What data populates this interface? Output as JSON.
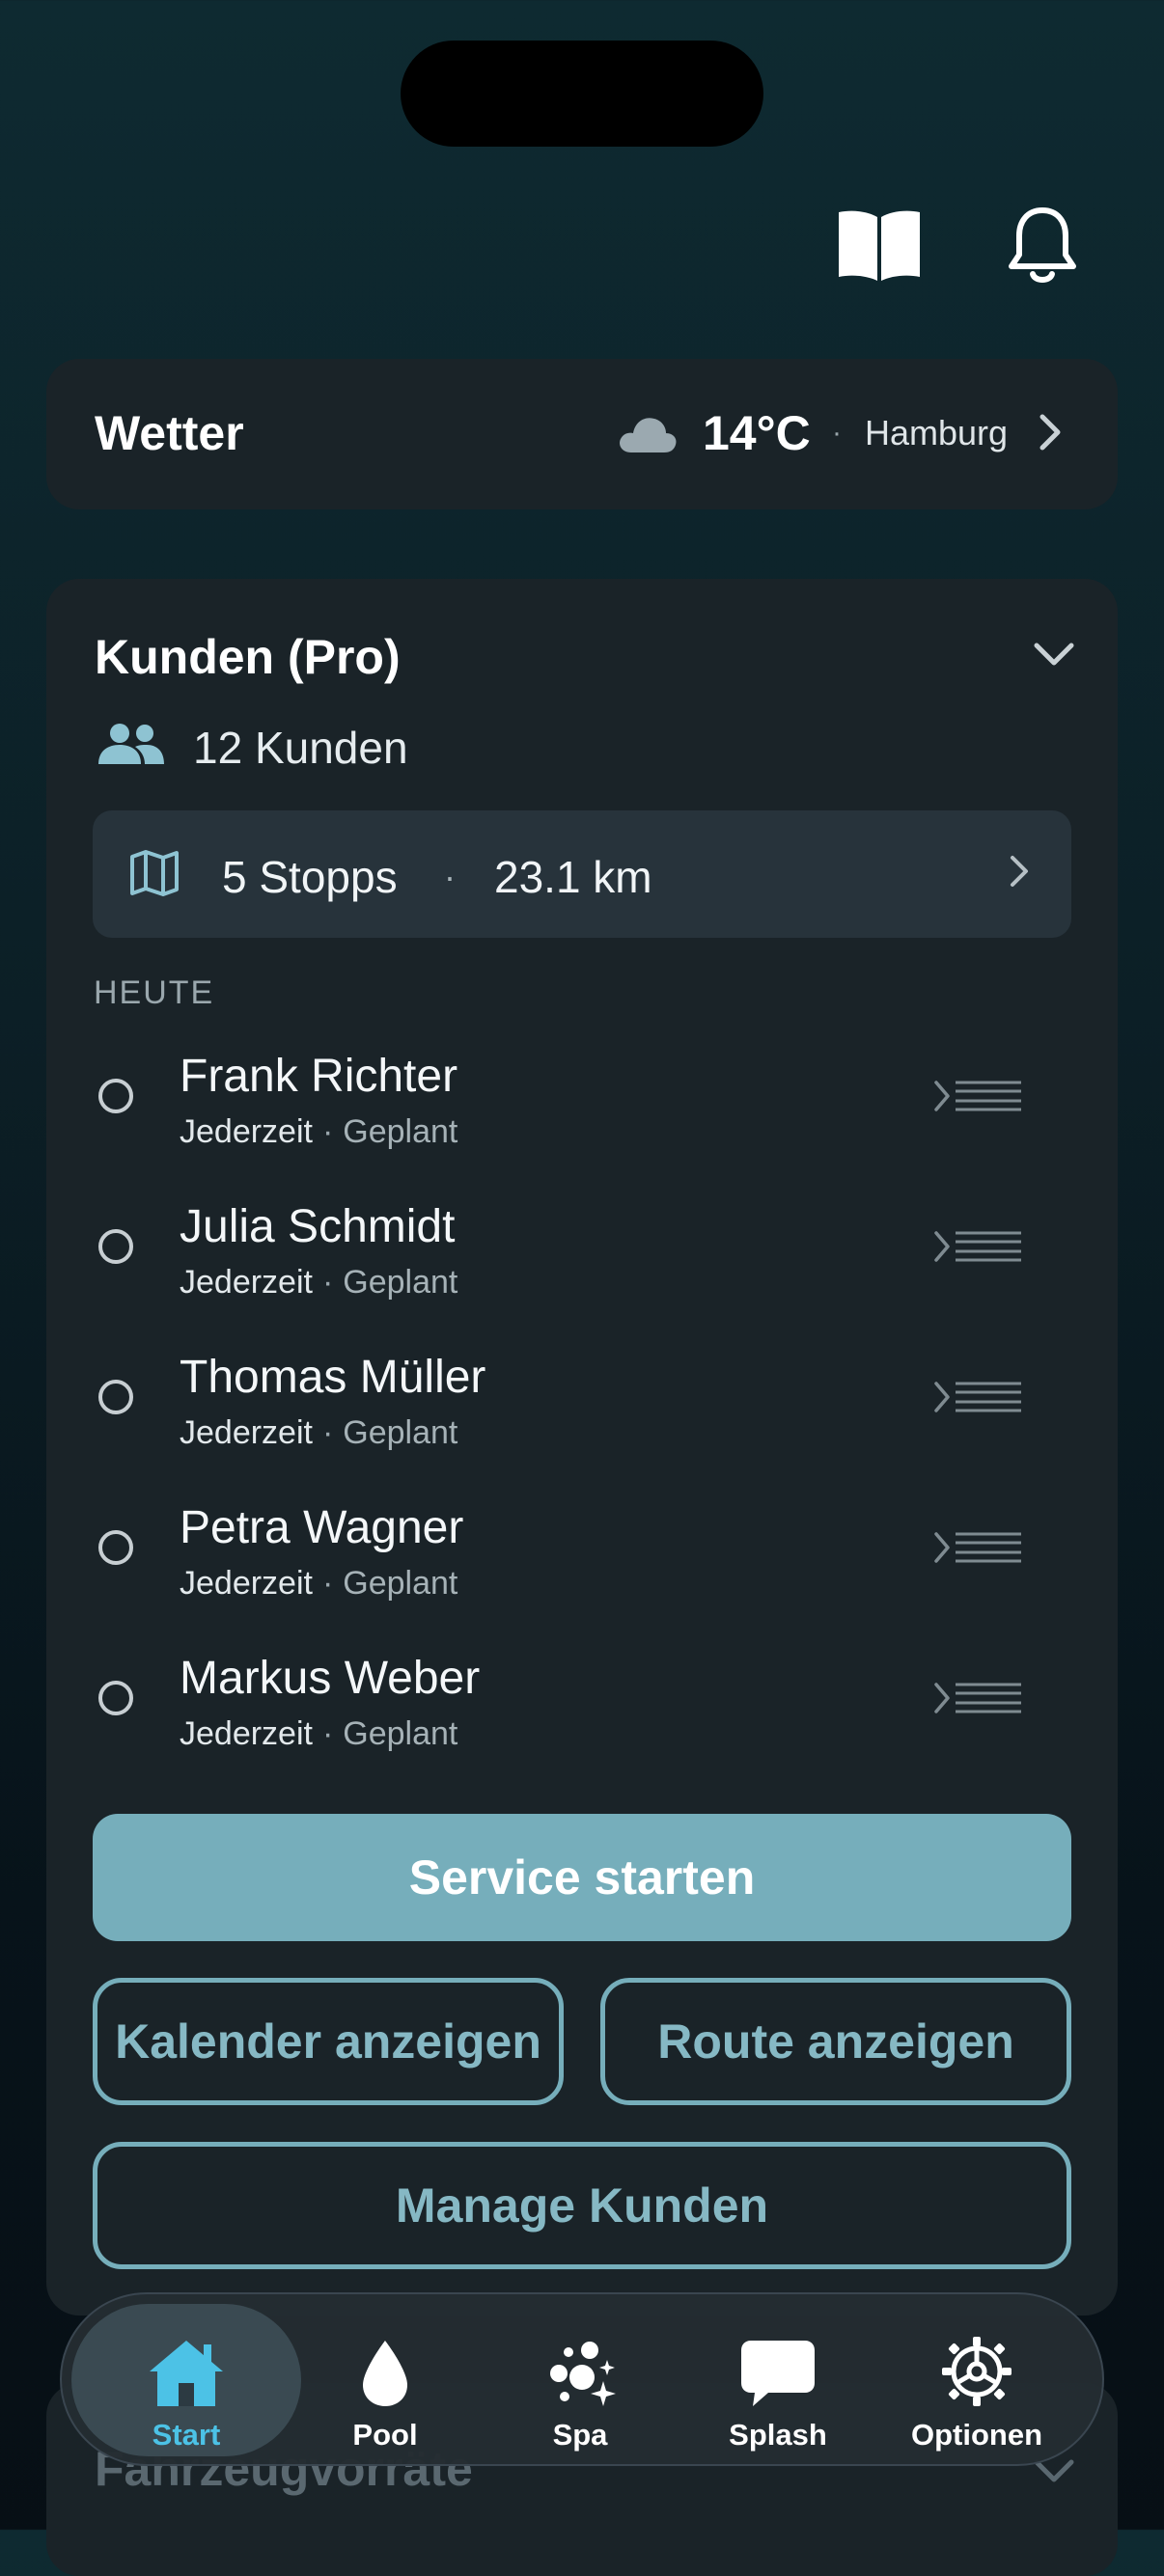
{
  "header": {
    "icons": [
      "book-icon",
      "bell-icon"
    ]
  },
  "weather": {
    "title": "Wetter",
    "icon": "cloud-icon",
    "temperature": "14°C",
    "separator": "·",
    "city": "Hamburg"
  },
  "customers": {
    "title": "Kunden (Pro)",
    "count_label": "12 Kunden",
    "route": {
      "stops": "5 Stopps",
      "separator": "·",
      "distance": "23.1 km"
    },
    "section_label": "HEUTE",
    "items": [
      {
        "name": "Frank Richter",
        "time": "Jederzeit",
        "status": "Geplant"
      },
      {
        "name": "Julia Schmidt",
        "time": "Jederzeit",
        "status": "Geplant"
      },
      {
        "name": "Thomas Müller",
        "time": "Jederzeit",
        "status": "Geplant"
      },
      {
        "name": "Petra Wagner",
        "time": "Jederzeit",
        "status": "Geplant"
      },
      {
        "name": "Markus Weber",
        "time": "Jederzeit",
        "status": "Geplant"
      }
    ],
    "item_separator": "·",
    "buttons": {
      "start_service": "Service starten",
      "show_calendar": "Kalender anzeigen",
      "show_route": "Route anzeigen",
      "manage": "Manage Kunden"
    }
  },
  "next_card": {
    "title": "Fahrzeugvorräte"
  },
  "tabbar": {
    "tabs": [
      {
        "label": "Start",
        "icon": "home-icon",
        "active": true
      },
      {
        "label": "Pool",
        "icon": "drop-icon",
        "active": false
      },
      {
        "label": "Spa",
        "icon": "bubbles-icon",
        "active": false
      },
      {
        "label": "Splash",
        "icon": "chat-bubble-icon",
        "active": false
      },
      {
        "label": "Optionen",
        "icon": "gear-icon",
        "active": false
      }
    ]
  },
  "colors": {
    "accent": "#76aebb",
    "active_tab": "#4cc2e6",
    "card": "#1a2328"
  }
}
